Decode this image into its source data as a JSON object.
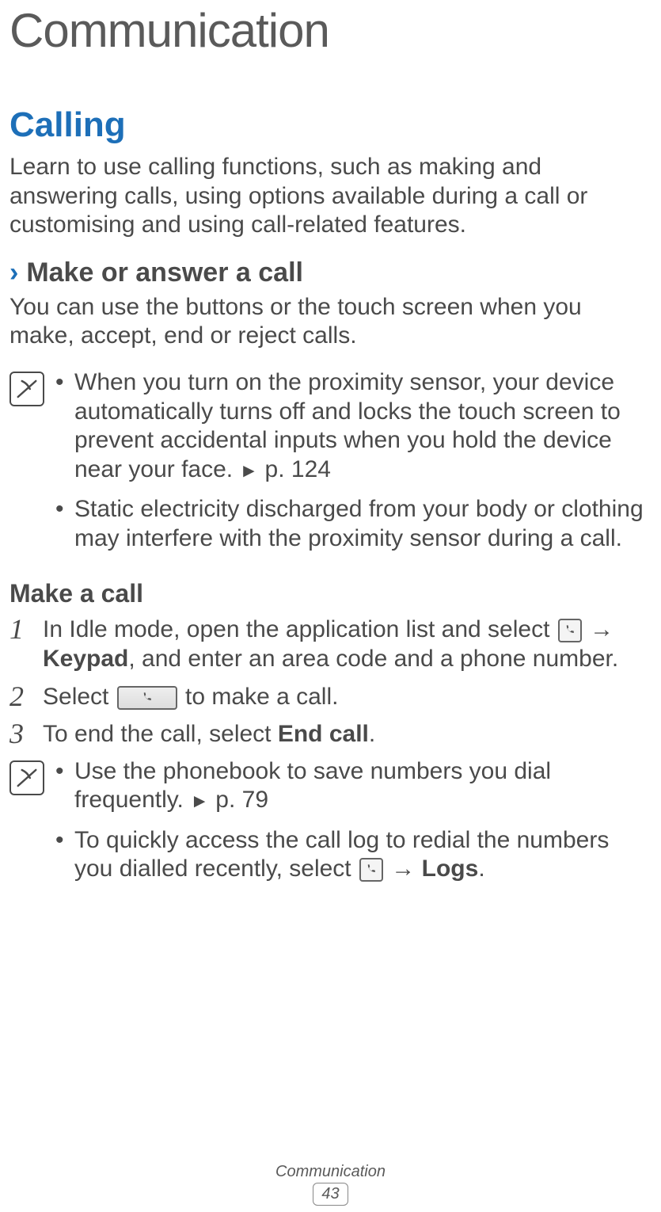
{
  "chapter": {
    "title": "Communication"
  },
  "section": {
    "title": "Calling"
  },
  "intro": "Learn to use calling functions, such as making and answering calls, using options available during a call or customising and using call-related features.",
  "sub1": {
    "chevron": "›",
    "title": "Make or answer a call",
    "lead": "You can use the buttons or the touch screen when you make, accept, end or reject calls."
  },
  "note1": {
    "item1_pre": "When you turn on the proximity sensor, your device automatically turns off and locks the touch screen to prevent accidental inputs when you hold the device near your face. ",
    "item1_ref_arrow": "►",
    "item1_ref": " p. 124",
    "item2": "Static electricity discharged from your body or clothing may interfere with the proximity sensor during a call."
  },
  "sub2": {
    "title": "Make a call"
  },
  "steps": {
    "s1_pre": "In Idle mode, open the application list and select ",
    "s1_arrow": " → ",
    "s1_bold": "Keypad",
    "s1_post": ", and enter an area code and a phone number.",
    "s2_pre": "Select ",
    "s2_post": " to make a call.",
    "s3_pre": "To end the call, select ",
    "s3_bold": "End call",
    "s3_post": "."
  },
  "note2": {
    "item1_pre": "Use the phonebook to save numbers you dial frequently. ",
    "item1_ref_arrow": "►",
    "item1_ref": " p. 79",
    "item2_pre": "To quickly access the call log to redial the numbers you dialled recently, select ",
    "item2_arrow": " → ",
    "item2_bold": "Logs",
    "item2_post": "."
  },
  "footer": {
    "label": "Communication",
    "page": "43"
  }
}
